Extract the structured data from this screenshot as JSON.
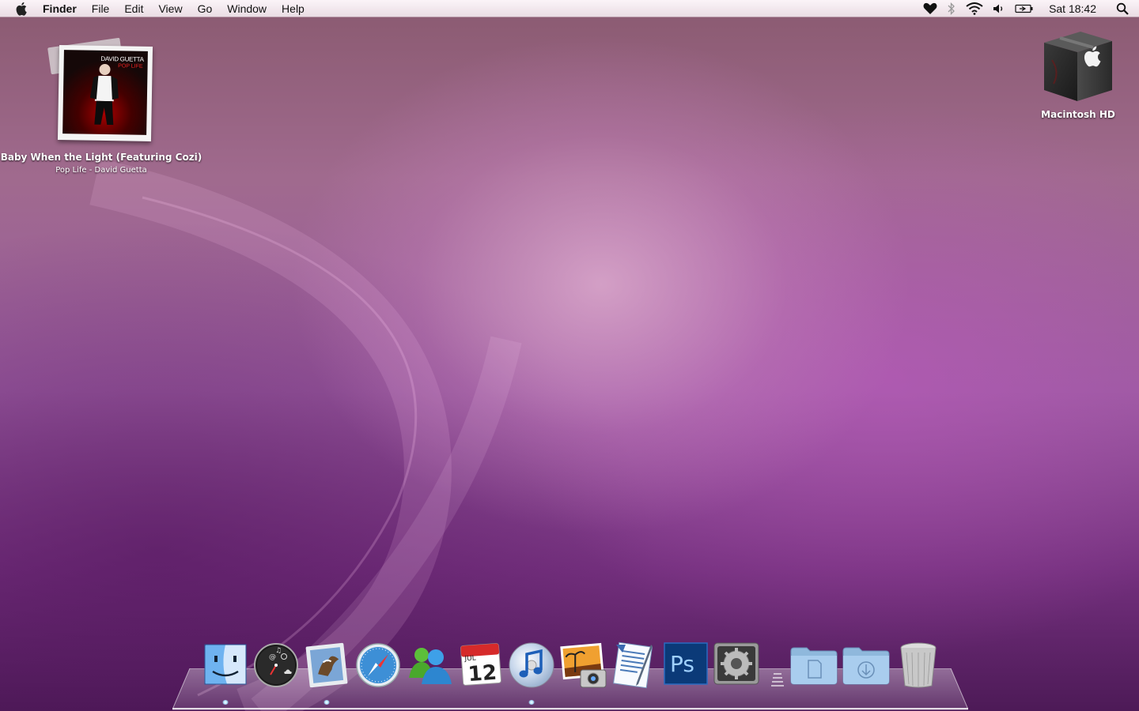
{
  "menubar": {
    "apple_icon": "apple-icon",
    "app_name": "Finder",
    "menus": [
      "File",
      "Edit",
      "View",
      "Go",
      "Window",
      "Help"
    ],
    "status_icons": [
      "heart-icon",
      "bluetooth-icon",
      "wifi-icon",
      "volume-icon",
      "battery-icon"
    ],
    "clock": "Sat 18:42",
    "spotlight_icon": "spotlight-search-icon"
  },
  "desktop": {
    "now_playing": {
      "track": "Baby When the Light (Featuring Cozi)",
      "subtitle": "Pop Life - David Guetta",
      "art_artist": "DAVID GUETTA",
      "art_album": "POP LIFE"
    },
    "hard_drive": {
      "label": "Macintosh HD"
    }
  },
  "dock": {
    "apps": [
      {
        "name": "Finder",
        "icon": "finder-icon",
        "running": true
      },
      {
        "name": "Dashboard",
        "icon": "dashboard-icon",
        "running": false
      },
      {
        "name": "Mail",
        "icon": "mail-icon",
        "running": true
      },
      {
        "name": "Safari",
        "icon": "safari-icon",
        "running": false
      },
      {
        "name": "Messenger",
        "icon": "messenger-icon",
        "running": false
      },
      {
        "name": "iCal",
        "icon": "ical-icon",
        "running": false,
        "month": "JUL",
        "day": "12"
      },
      {
        "name": "iTunes",
        "icon": "itunes-icon",
        "running": true
      },
      {
        "name": "iPhoto",
        "icon": "iphoto-icon",
        "running": false
      },
      {
        "name": "TextEdit",
        "icon": "textedit-icon",
        "running": false
      },
      {
        "name": "Photoshop",
        "icon": "photoshop-icon",
        "running": false,
        "label": "Ps"
      },
      {
        "name": "System Preferences",
        "icon": "system-preferences-icon",
        "running": false
      }
    ],
    "stacks": [
      {
        "name": "Documents",
        "icon": "documents-folder-icon"
      },
      {
        "name": "Downloads",
        "icon": "downloads-folder-icon"
      },
      {
        "name": "Trash",
        "icon": "trash-icon"
      }
    ]
  }
}
